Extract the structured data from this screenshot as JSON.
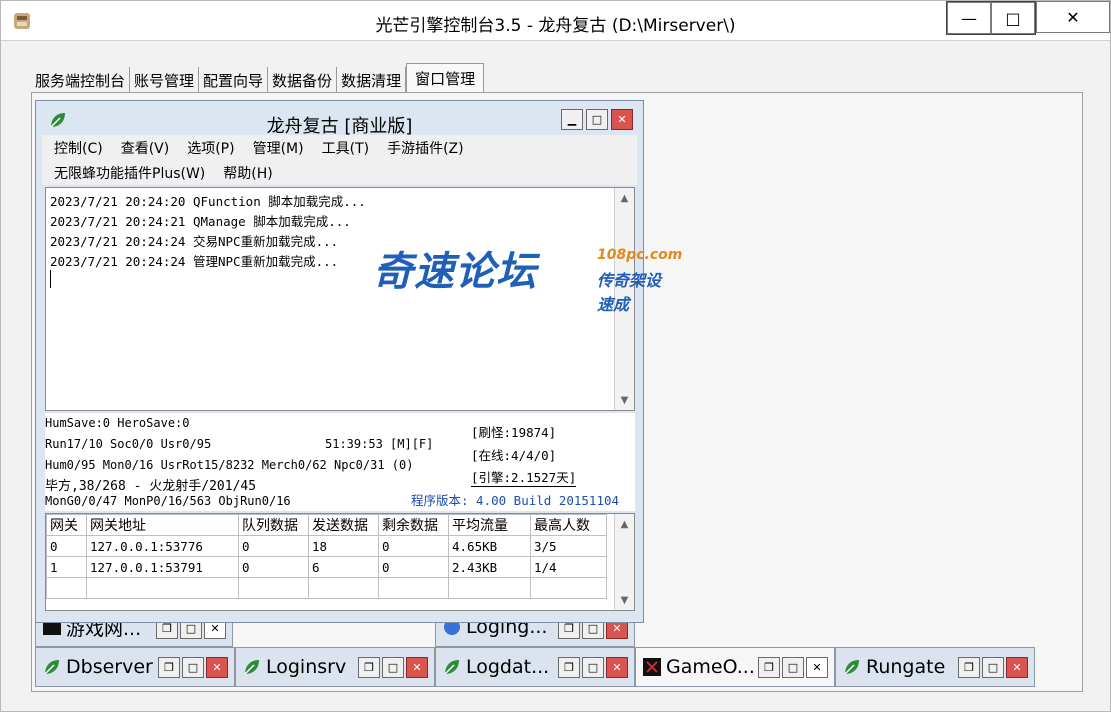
{
  "window": {
    "title": "光芒引擎控制台3.5 - 龙舟复古 (D:\\Mirserver\\)",
    "min": "—",
    "max": "□",
    "close": "✕"
  },
  "tabs": [
    {
      "label": "服务端控制台"
    },
    {
      "label": "账号管理"
    },
    {
      "label": "配置向导"
    },
    {
      "label": "数据备份"
    },
    {
      "label": "数据清理"
    },
    {
      "label": "窗口管理",
      "active": true
    }
  ],
  "main": {
    "title": "龙舟复古 [商业版]",
    "menu_row1": [
      "控制(C)",
      "查看(V)",
      "选项(P)",
      "管理(M)",
      "工具(T)",
      "手游插件(Z)"
    ],
    "menu_row2": [
      "无限蜂功能插件Plus(W)",
      "帮助(H)"
    ],
    "log": [
      "2023/7/21 20:24:20 QFunction 脚本加载完成...",
      "2023/7/21 20:24:21 QManage 脚本加载完成...",
      "2023/7/21 20:24:24 交易NPC重新加载完成...",
      "2023/7/21 20:24:24 管理NPC重新加载完成..."
    ],
    "stats": {
      "line1": "HumSave:0 HeroSave:0",
      "line2": "Run17/10 Soc0/0 Usr0/95",
      "time": "51:39:53 [M][F]",
      "line3": "Hum0/95 Mon0/16 UsrRot15/8232 Merch0/62 Npc0/31 (0)",
      "line4": "毕方,38/268 - 火龙射手/201/45",
      "line5": "MonG0/0/47 MonP0/16/563 ObjRun0/16",
      "refresh": "[刷怪:19874]",
      "online": "[在线:4/4/0]",
      "engine": "[引擎:2.1527天]",
      "version": "程序版本: 4.00 Build 20151104"
    },
    "gateway": {
      "headers": [
        "网关",
        "网关地址",
        "队列数据",
        "发送数据",
        "剩余数据",
        "平均流量",
        "最高人数"
      ],
      "rows": [
        [
          "0",
          "127.0.0.1:53776",
          "0",
          "18",
          "0",
          "4.65KB",
          "3/5"
        ],
        [
          "1",
          "127.0.0.1:53791",
          "0",
          "6",
          "0",
          "2.43KB",
          "1/4"
        ]
      ]
    }
  },
  "watermark": {
    "text": "奇速论坛",
    "url": "108pc.com",
    "sub": "传奇架设速成"
  },
  "mdi_windows": {
    "game_net": "游戏网...",
    "loging": "Loging...",
    "dbserver": "Dbserver",
    "loginsrv": "Loginsrv",
    "logdat": "Logdat...",
    "gameo": "GameO...",
    "rungate": "Rungate"
  },
  "colors": {
    "close_red": "#d9534f",
    "version_blue": "#1f4fb0",
    "watermark_blue": "#1f5fb8",
    "watermark_orange": "#e08a1e"
  }
}
